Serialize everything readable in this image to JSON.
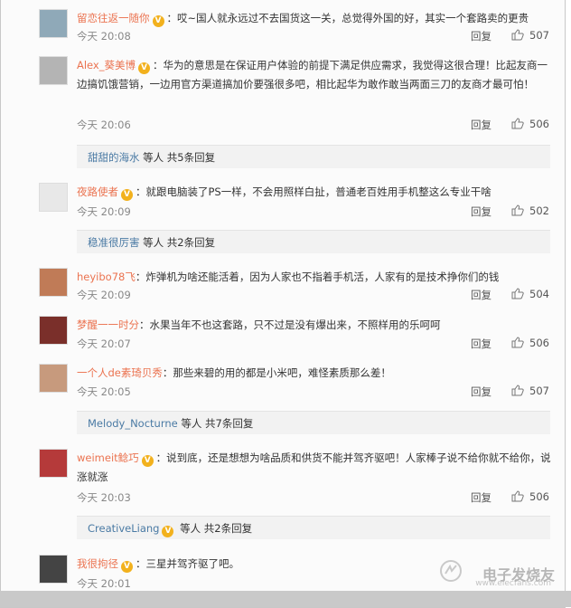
{
  "colors": {
    "username": "#eb7350",
    "subuser": "#4a7aa4",
    "badge": "#f2b11d",
    "meta": "#888888"
  },
  "ui": {
    "reply_label": "回复",
    "thumb_icon": "thumbs-up-icon",
    "badge_label": "V"
  },
  "comments": [
    {
      "user": "留恋往返一随你",
      "text": "：哎~国人就永远过不去国货这一关，总觉得外国的好，其实一个套路卖的更贵",
      "time": "今天 20:08",
      "likes": "507",
      "avatar_color": "#8fa9b8"
    },
    {
      "user": "Alex_葵美博",
      "text": "：华为的意思是在保证用户体验的前提下满足供应需求，我觉得这很合理！比起友商一边搞饥饿营销，一边用官方渠道搞加价要强很多吧，相比起华为敢作敢当两面三刀的友商才最可怕！",
      "time": "今天 20:06",
      "likes": "506",
      "avatar_color": "#b4b4b4",
      "sub": {
        "user": "甜甜的海水",
        "suffix": " 等人 共5条回复"
      }
    },
    {
      "user": "夜路使者",
      "text": "：就跟电脑装了PS一样，不会用照样白扯，普通老百姓用手机整这么专业干啥",
      "time": "今天 20:09",
      "likes": "502",
      "avatar_color": "#e8e8e8",
      "sub": {
        "user": "稳准很厉害",
        "suffix": " 等人 共2条回复"
      }
    },
    {
      "user": "heyibo78飞",
      "text": "：炸弹机为啥还能活着，因为人家也不指着手机活，人家有的是技术挣你们的钱",
      "time": "今天 20:09",
      "likes": "504",
      "avatar_color": "#c07b57"
    },
    {
      "user": "梦醒一一时分",
      "text": "：水果当年不也这套路，只不过是没有爆出来，不照样用的乐呵呵",
      "time": "今天 20:07",
      "likes": "506",
      "avatar_color": "#7a2f2a"
    },
    {
      "user": "一个人de素琦贝秀",
      "text": "：那些来碧的用的都是小米吧，难怪素质那么差！",
      "time": "今天 20:05",
      "likes": "507",
      "avatar_color": "#c79a7d",
      "sub": {
        "user": "Melody_Nocturne",
        "suffix": " 等人 共7条回复"
      }
    },
    {
      "user": "weimeit鲶巧",
      "text": "：说到底，还是想想为啥品质和供货不能并驾齐驱吧！人家棒子说不给你就不给你，说涨就涨",
      "time": "今天 20:03",
      "likes": "506",
      "avatar_color": "#b53a3a",
      "sub": {
        "user": "CreativeLiang",
        "suffix": " 等人 共2条回复"
      }
    },
    {
      "user": "我很拘径",
      "text": "：三星并驾齐驱了吧。",
      "time": "今天 20:01",
      "likes": "",
      "avatar_color": "#444444"
    }
  ],
  "watermark": {
    "title": "电子发烧友",
    "url": "www.elecfans.com"
  }
}
